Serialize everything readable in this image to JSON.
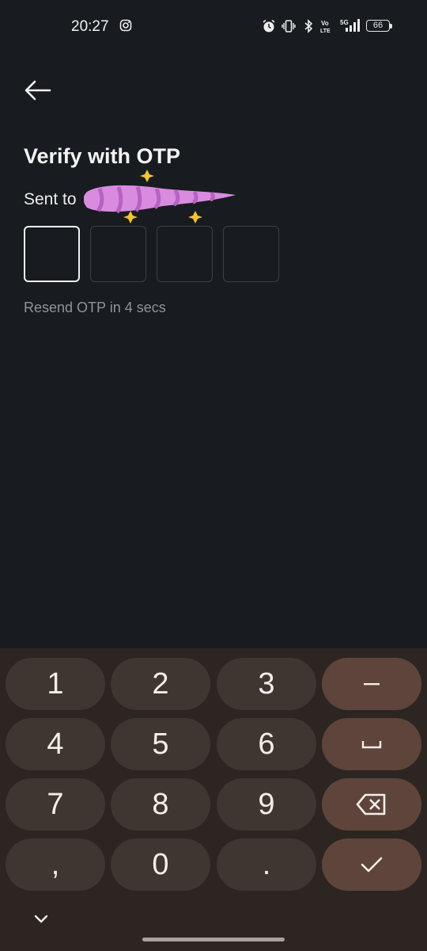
{
  "status_bar": {
    "time": "20:27",
    "battery": "66",
    "icons": [
      "instagram-icon",
      "alarm-icon",
      "vibrate-icon",
      "bluetooth-icon",
      "volte-icon",
      "signal-5g-icon",
      "battery-icon"
    ]
  },
  "header": {
    "back_icon": "arrow-left-icon",
    "title": "Verify with OTP",
    "sent_to_label": "Sent to"
  },
  "otp": {
    "digits": [
      "",
      "",
      "",
      ""
    ],
    "resend_text": "Resend OTP in 4 secs"
  },
  "keyboard": {
    "keys": [
      "1",
      "2",
      "3",
      "−",
      "4",
      "5",
      "6",
      "␣",
      "7",
      "8",
      "9",
      "⌫",
      ",",
      "0",
      ".",
      "✓"
    ],
    "collapse_icon": "chevron-down-icon"
  },
  "colors": {
    "background": "#181b20",
    "keyboard_bg": "#2c2521",
    "key_bg": "#3f3531",
    "fn_key_bg": "#5e443a",
    "redaction": "#d98be0"
  }
}
